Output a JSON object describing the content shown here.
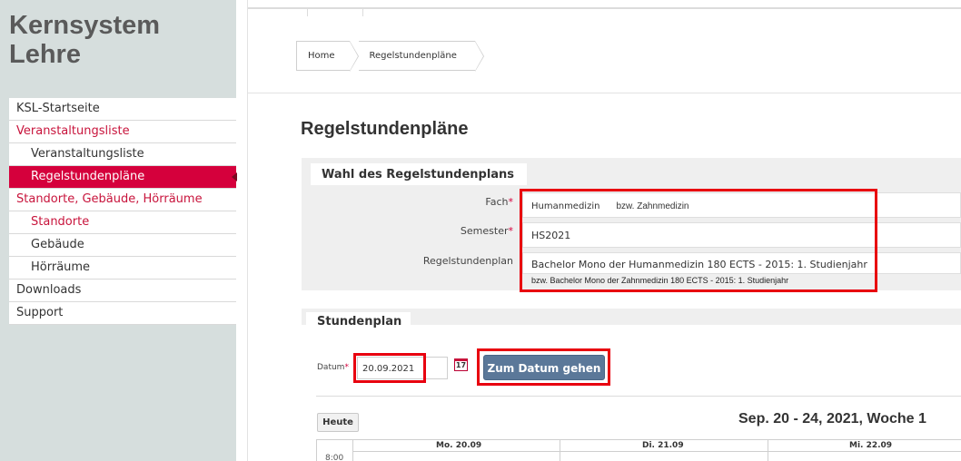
{
  "brand": {
    "line1": "Kernsystem",
    "line2": "Lehre"
  },
  "sidebar": {
    "items": [
      {
        "label": "KSL-Startseite"
      },
      {
        "label": "Veranstaltungsliste"
      },
      {
        "label": "Veranstaltungsliste"
      },
      {
        "label": "Regelstundenpläne"
      },
      {
        "label": "Standorte, Gebäude, Hörräume"
      },
      {
        "label": "Standorte"
      },
      {
        "label": "Gebäude"
      },
      {
        "label": "Hörräume"
      },
      {
        "label": "Downloads"
      },
      {
        "label": "Support"
      }
    ]
  },
  "breadcrumb": {
    "home": "Home",
    "current": "Regelstundenpläne"
  },
  "page": {
    "title": "Regelstundenpläne"
  },
  "wahl": {
    "tab": "Wahl des Regelstundenplans",
    "fach_label": "Fach",
    "fach_value": "Humanmedizin",
    "fach_alt": "bzw. Zahnmedizin",
    "semester_label": "Semester",
    "semester_value": "HS2021",
    "plan_label": "Regelstundenplan",
    "plan_value": "Bachelor Mono der Humanmedizin 180 ECTS - 2015: 1. Studienjahr",
    "plan_alt": "bzw. Bachelor Mono der Zahnmedizin 180 ECTS - 2015: 1. Studienjahr",
    "required_mark": "*"
  },
  "stundenplan": {
    "tab": "Stundenplan",
    "datum_label": "Datum",
    "datum_value": "20.09.2021",
    "calendar_icon_text": "17",
    "goto_button": "Zum Datum gehen",
    "today_button": "Heute",
    "week_title": "Sep. 20 - 24, 2021, Woche 1",
    "days": [
      "Mo. 20.09",
      "Di. 21.09",
      "Mi. 22.09"
    ],
    "first_time": "8:00"
  },
  "colors": {
    "accent": "#d5003c",
    "highlight": "#e8000f",
    "button": "#5b7899",
    "sidebar_bg": "#d6dedd"
  }
}
